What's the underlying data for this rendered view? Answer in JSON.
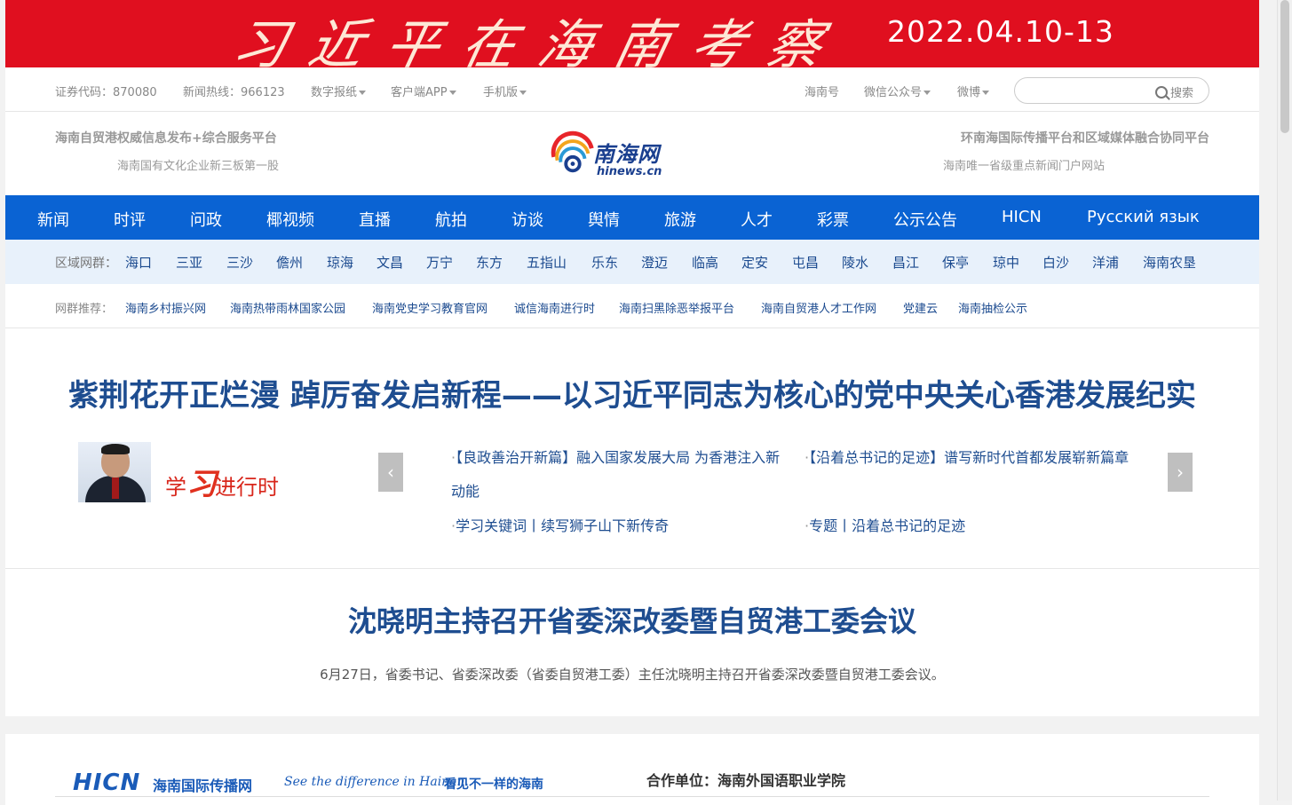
{
  "banner": {
    "title": "习近平在海南考察",
    "date": "2022.04.10-13"
  },
  "topbar": {
    "stock_code": "证券代码：870080",
    "hotline": "新闻热线：966123",
    "digital_paper": "数字报纸",
    "client_app": "客户端APP",
    "mobile": "手机版",
    "hainan_hao": "海南号",
    "wechat": "微信公众号",
    "weibo": "微博",
    "search_placeholder": "",
    "search_label": "搜索"
  },
  "header": {
    "left_line1": "海南自贸港权威信息发布+综合服务平台",
    "left_line2": "海南国有文化企业新三板第一股",
    "right_line1": "环南海国际传播平台和区域媒体融合协同平台",
    "right_line2": "海南唯一省级重点新闻门户网站",
    "logo_cn": "南海网",
    "logo_en": "hinews.cn"
  },
  "nav": [
    "新闻",
    "时评",
    "问政",
    "椰视频",
    "直播",
    "航拍",
    "访谈",
    "舆情",
    "旅游",
    "人才",
    "彩票",
    "公示公告",
    "HICN",
    "Русский язык"
  ],
  "region": {
    "label": "区域网群：",
    "items": [
      "海口",
      "三亚",
      "三沙",
      "儋州",
      "琼海",
      "文昌",
      "万宁",
      "东方",
      "五指山",
      "乐东",
      "澄迈",
      "临高",
      "定安",
      "屯昌",
      "陵水",
      "昌江",
      "保亭",
      "琼中",
      "白沙",
      "洋浦",
      "海南农垦"
    ]
  },
  "network": {
    "label": "网群推荐：",
    "items": [
      "海南乡村振兴网",
      "海南热带雨林国家公园",
      "海南党史学习教育官网",
      "诚信海南进行时",
      "海南扫黑除恶举报平台",
      "海南自贸港人才工作网",
      "党建云",
      "海南抽检公示"
    ]
  },
  "headline": {
    "title": "紫荆花开正烂漫 踔厉奋发启新程——以习近平同志为核心的党中央关心香港发展纪实",
    "study_prefix": "学",
    "study_big": "习",
    "study_suffix": "进行时",
    "prev_arrow": "‹",
    "next_arrow": "›",
    "links": [
      "【良政善治开新篇】融入国家发展大局 为香港注入新动能",
      "【沿着总书记的足迹】谱写新时代首都发展崭新篇章",
      "学习关键词丨续写狮子山下新传奇",
      "专题丨沿着总书记的足迹"
    ]
  },
  "second": {
    "title": "沈晓明主持召开省委深改委暨自贸港工委会议",
    "summary": "6月27日，省委书记、省委深改委（省委自贸港工委）主任沈晓明主持召开省委深改委暨自贸港工委会议。"
  },
  "hicn": {
    "logo": "HICN",
    "name": "海南国际传播网",
    "slogan_en": "See the difference in Hainan.",
    "slogan_cn": "看见不一样的海南",
    "partner": "合作单位：海南外国语职业学院"
  }
}
